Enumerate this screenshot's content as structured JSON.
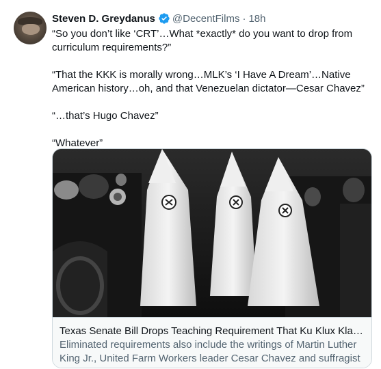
{
  "tweet": {
    "author": {
      "name": "Steven D. Greydanus",
      "handle": "@DecentFilms",
      "separator": "·",
      "time": "18h",
      "verified_color": "#1d9bf0"
    },
    "paragraphs": [
      "“So you don’t like ‘CRT’…What *exactly* do you want to drop from curriculum requirements?”",
      "“That the KKK is morally wrong…MLK’s ‘I Have A Dream’…Native American history…oh, and that Venezuelan dictator—Cesar Chavez”",
      "“…that’s Hugo Chavez”",
      "“Whatever”"
    ],
    "card": {
      "title": "Texas Senate Bill Drops Teaching Requirement That Ku Klux Klan Is ‘M…",
      "description": "Eliminated requirements also include the writings of Martin Luther King Jr., United Farm Workers leader Cesar Chavez and suffragist Susan B. …"
    }
  },
  "colors": {
    "accent": "#1d9bf0",
    "text": "#0f1419",
    "secondary": "#536471",
    "border": "#cfd9de",
    "card_bg": "#f7f9f9"
  }
}
